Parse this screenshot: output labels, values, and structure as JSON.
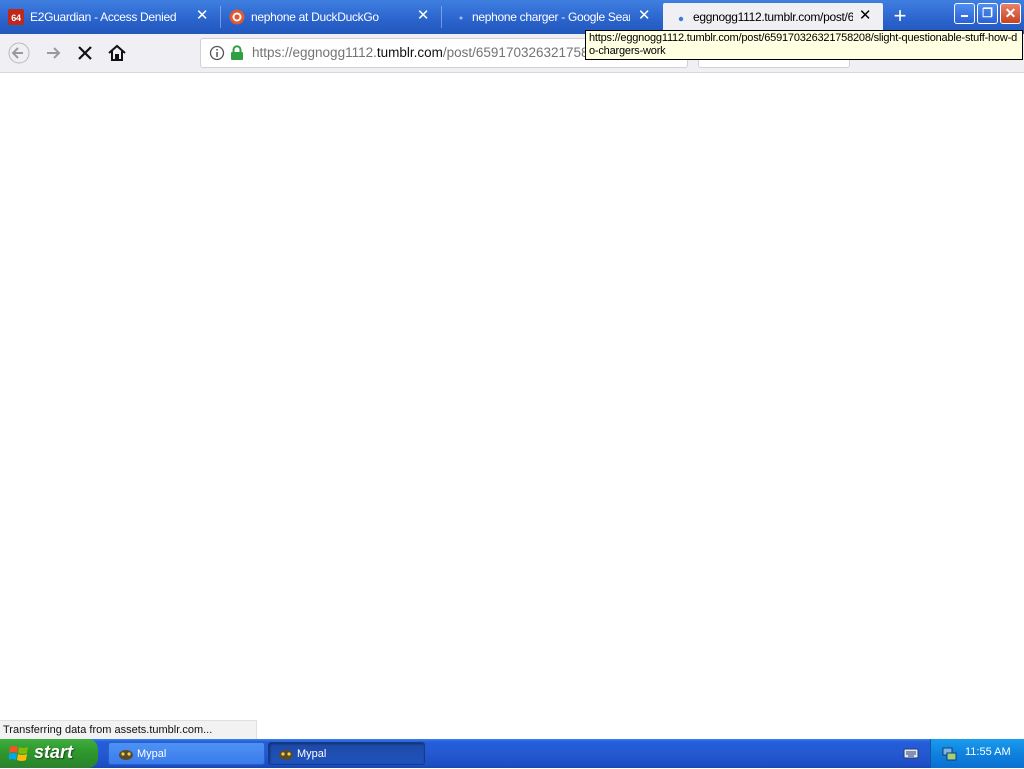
{
  "browser": {
    "tabs": [
      {
        "title": "E2Guardian - Access Denied",
        "favicon": "e2guardian-icon",
        "favicon_text": "64",
        "active": false
      },
      {
        "title": "nephone at DuckDuckGo",
        "favicon": "duckduckgo-icon",
        "active": false
      },
      {
        "title": "nephone charger - Google Search",
        "favicon": "google-icon",
        "active": false
      },
      {
        "title": "eggnogg1112.tumblr.com/post/6",
        "favicon": "loading-dot-icon",
        "active": true
      }
    ],
    "new_tab_symbol": "+",
    "url": {
      "prefix": "https://eggnogg1112.",
      "host": "tumblr.com",
      "path": "/post/659170326321758208/slight-questionable-stuff-how-do-chargers-work"
    },
    "tooltip": "https://eggnogg1112.tumblr.com/post/659170326321758208/slight-questionable-stuff-how-do-chargers-work",
    "status": "Transferring data from assets.tumblr.com..."
  },
  "taskbar": {
    "start_label": "start",
    "items": [
      {
        "label": "Mypal",
        "active": false
      },
      {
        "label": "Mypal",
        "active": true
      }
    ],
    "clock": "11:55 AM"
  },
  "colors": {
    "tabstrip": "#2a63cc",
    "active_tab": "#f0f0f4",
    "secure_lock": "#2ea043",
    "start_button": "#2f9a2f",
    "taskbar": "#2559d1",
    "tooltip_bg": "#ffffe1"
  }
}
